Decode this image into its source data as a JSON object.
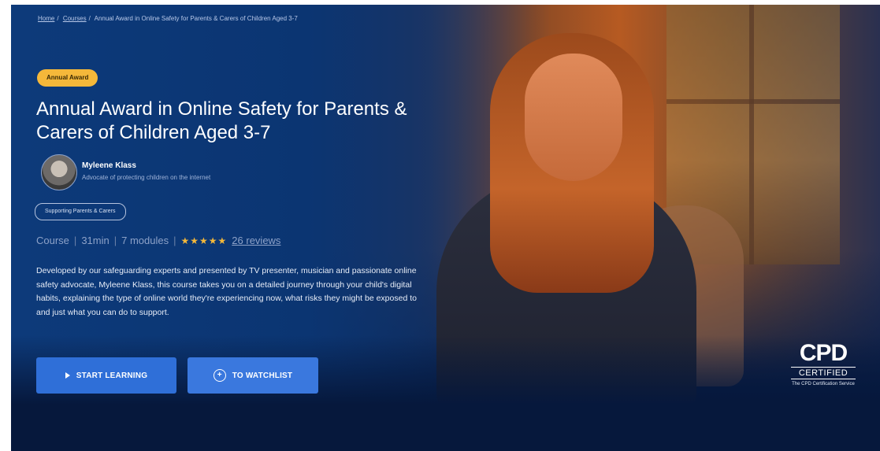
{
  "breadcrumb": {
    "home": "Home",
    "sep1": "/",
    "courses": "Courses",
    "sep2": "/",
    "current": "Annual Award in Online Safety for Parents & Carers of Children Aged 3-7"
  },
  "badge": "Annual Award",
  "course": {
    "title": "Annual Award in Online Safety for Parents & Carers of Children Aged 3-7"
  },
  "author": {
    "name": "Myleene Klass",
    "role": "Advocate of protecting children on the internet"
  },
  "tag": "Supporting Parents & Carers",
  "meta": {
    "type": "Course",
    "duration": "31min",
    "modules": "7 modules",
    "rating_stars": 5,
    "stars_text": "★★★★★",
    "reviews": "26 reviews",
    "sep": "|"
  },
  "description": "Developed by our safeguarding experts and presented by TV presenter, musician and passionate online safety advocate, Myleene Klass, this course takes you on a detailed journey through your child's digital habits, explaining the type of online world they're experiencing now, what risks they might be exposed to and just what you can do to support.",
  "buttons": {
    "start": "START LEARNING",
    "watchlist": "TO WATCHLIST"
  },
  "cpd": {
    "big": "CPD",
    "certified": "CERTIFIED",
    "sub": "The CPD Certification Service"
  },
  "colors": {
    "hero_blue": "#0d3a7a",
    "accent_yellow": "#f5b83a",
    "button_blue": "#2f6fd8"
  }
}
